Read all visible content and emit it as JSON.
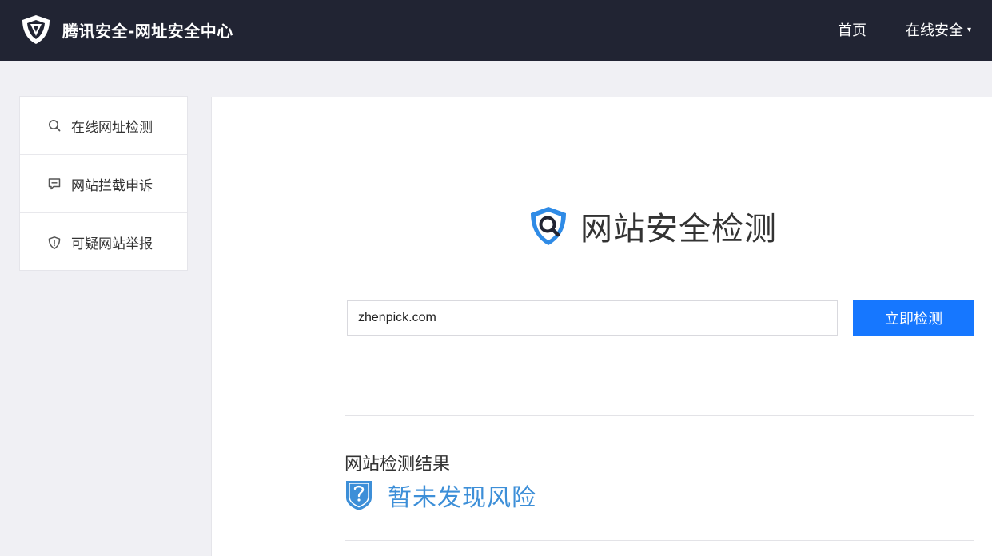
{
  "header": {
    "title": "腾讯安全-网址安全中心",
    "nav": {
      "home": "首页",
      "online_security": "在线安全",
      "online_security_caret": "▾"
    }
  },
  "sidebar": {
    "items": [
      {
        "label": "在线网址检测",
        "icon": "search-icon"
      },
      {
        "label": "网站拦截申诉",
        "icon": "message-icon"
      },
      {
        "label": "可疑网站举报",
        "icon": "shield-alert-icon"
      }
    ]
  },
  "main": {
    "hero_title": "网站安全检测",
    "url_input_value": "zhenpick.com",
    "check_button": "立即检测",
    "result_label": "网站检测结果",
    "result_status": "暂未发现风险"
  },
  "colors": {
    "header_bg": "#212433",
    "primary": "#1677ff",
    "result_text": "#3d8fd8"
  }
}
